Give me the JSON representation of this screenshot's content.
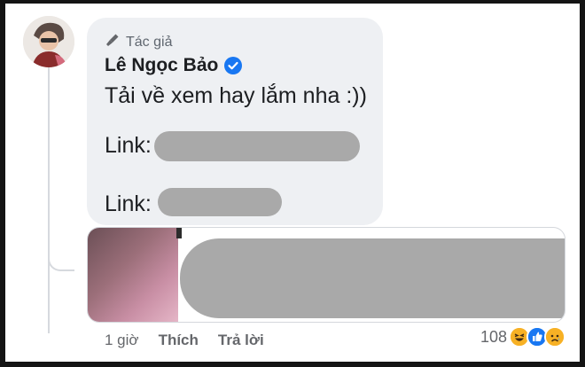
{
  "comment": {
    "author_badge": "Tác giả",
    "author_name": "Lê Ngọc Bảo",
    "text": "Tải về xem hay lắm nha :))",
    "link_1_label": "Link:",
    "link_2_label": "Link:",
    "author_badge_icon": "microphone-icon",
    "verified_icon": "verified-badge-icon",
    "verified_color": "#1877f2"
  },
  "actions": {
    "time": "1 giờ",
    "like_label": "Thích",
    "reply_label": "Trả lời"
  },
  "reactions": {
    "count": "108",
    "icons": [
      "haha-reaction-icon",
      "like-reaction-icon",
      "sad-reaction-icon"
    ]
  }
}
